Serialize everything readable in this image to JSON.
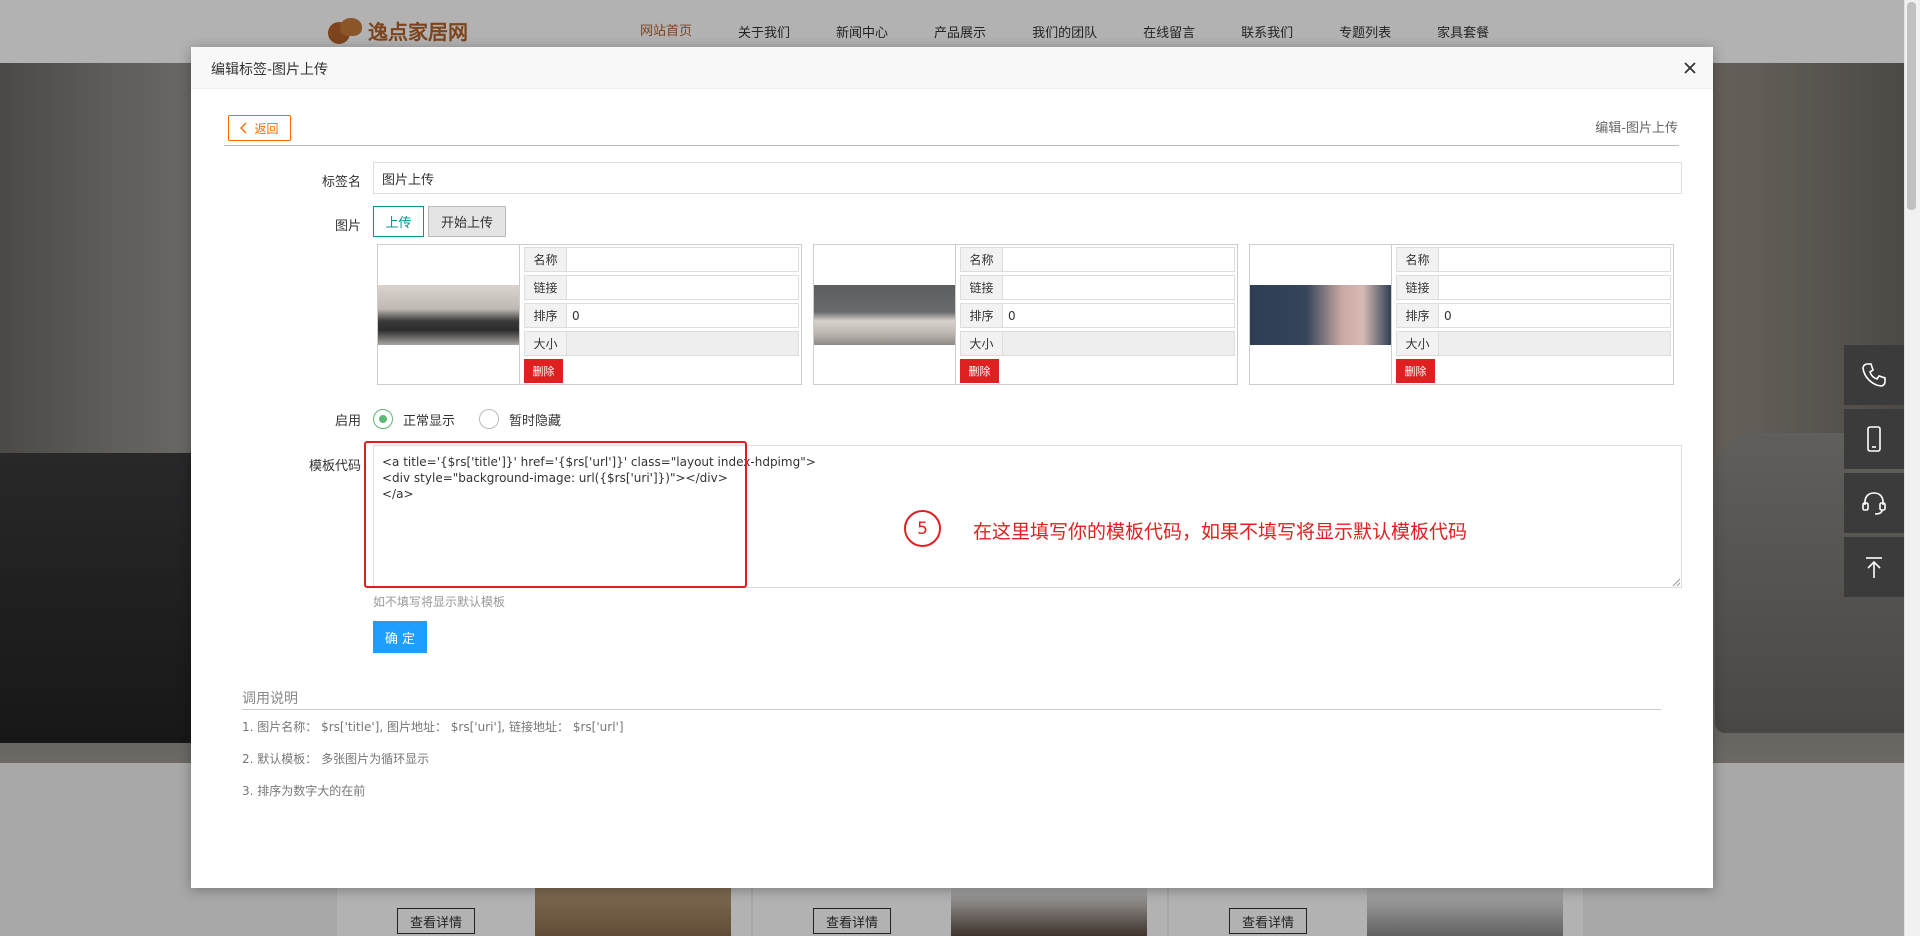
{
  "site": {
    "logo_text": "逸点家居网",
    "nav": [
      "网站首页",
      "关于我们",
      "新闻中心",
      "产品展示",
      "我们的团队",
      "在线留言",
      "联系我们",
      "专题列表",
      "家具套餐"
    ],
    "detail_button": "查看详情"
  },
  "modal": {
    "title": "编辑标签-图片上传",
    "back_label": "返回",
    "breadcrumb": "编辑-图片上传",
    "tag_name_label": "标签名",
    "tag_name_value": "图片上传",
    "image_label": "图片",
    "upload_button": "上传",
    "start_upload_button": "开始上传",
    "image_cards": [
      {
        "name_key": "名称",
        "name_value": "",
        "link_key": "链接",
        "link_value": "",
        "order_key": "排序",
        "order_value": "0",
        "size_key": "大小",
        "size_value": "",
        "delete_label": "删除"
      },
      {
        "name_key": "名称",
        "name_value": "",
        "link_key": "链接",
        "link_value": "",
        "order_key": "排序",
        "order_value": "0",
        "size_key": "大小",
        "size_value": "",
        "delete_label": "删除"
      },
      {
        "name_key": "名称",
        "name_value": "",
        "link_key": "链接",
        "link_value": "",
        "order_key": "排序",
        "order_value": "0",
        "size_key": "大小",
        "size_value": "",
        "delete_label": "删除"
      }
    ],
    "enable_label": "启用",
    "radio_show": "正常显示",
    "radio_hide": "暂时隐藏",
    "radio_selected": "正常显示",
    "template_label": "模板代码",
    "template_code": [
      "<a title='{$rs['title']}' href='{$rs['url']}' class=\"layout index-hdpimg\">",
      "<div style=\"background-image: url({$rs['uri']})\"></div>",
      "</a>"
    ],
    "annotation_number": "5",
    "annotation_text": "在这里填写你的模板代码，如果不填写将显示默认模板代码",
    "template_hint": "如不填写将显示默认模板",
    "ok_button": "确 定",
    "usage_title": "调用说明",
    "usage_items": [
      "1. 图片名称：  $rs['title'], 图片地址：  $rs['uri'], 链接地址：  $rs['url']",
      "2. 默认模板：  多张图片为循环显示",
      "3. 排序为数字大的在前"
    ]
  },
  "colors": {
    "accent_orange": "#ff6a00",
    "teal": "#009688",
    "primary_blue": "#1e9fff",
    "danger_red": "#e02020",
    "radio_green": "#5fb878",
    "brand_brown": "#b4622a"
  },
  "icons": [
    "close-icon",
    "chevron-left-icon",
    "phone-icon",
    "mobile-icon",
    "headset-icon",
    "back-to-top-icon"
  ]
}
